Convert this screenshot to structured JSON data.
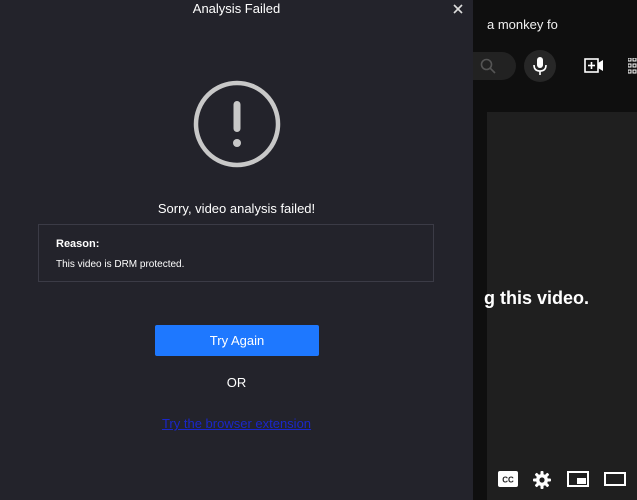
{
  "colors": {
    "dialog_bg": "#23232b",
    "primary_button": "#1e78ff",
    "link": "#1a27c9",
    "border": "#3b3b46",
    "icon": "#c8c8c8"
  },
  "background_page": {
    "tab_title": "a monkey fo",
    "video_message": "g this video.",
    "icons": [
      "search-icon",
      "microphone-icon",
      "create-video-icon",
      "apps-grid-icon",
      "closed-captions-icon",
      "settings-gear-icon",
      "miniplayer-icon",
      "theater-mode-icon"
    ]
  },
  "dialog": {
    "title": "Analysis Failed",
    "close_icon": "close-icon",
    "status_icon": "exclamation-circle-icon",
    "message": "Sorry, video analysis failed!",
    "reason": {
      "label": "Reason:",
      "text": "This video is DRM protected."
    },
    "try_again_label": "Try Again",
    "or_label": "OR",
    "extension_link": "Try the browser extension"
  }
}
